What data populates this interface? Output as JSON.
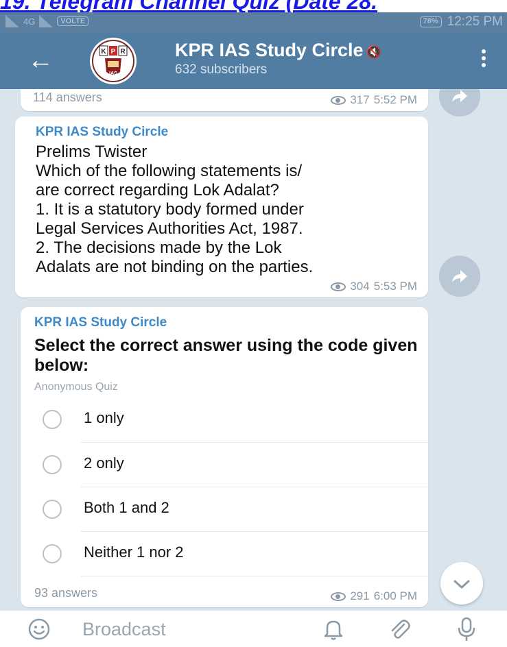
{
  "banner": {
    "text": "19. Telegram Channel Quiz (Date 28."
  },
  "status_bar": {
    "network": "4G",
    "volte": "VOLTE",
    "battery": "78%",
    "time": "12:25 PM"
  },
  "header": {
    "channel_name": "KPR IAS Study Circle",
    "subscribers": "632 subscribers",
    "avatar_text": "KPR"
  },
  "messages": [
    {
      "answers": "114 answers",
      "views": "317",
      "time": "5:52 PM"
    },
    {
      "sender": "KPR IAS Study Circle",
      "body": "Prelims Twister\nWhich of the following statements is/\nare correct regarding Lok Adalat?\n1.  It is a statutory body formed under\nLegal Services Authorities Act, 1987.\n2.  The decisions made by the Lok\nAdalats are not binding on the parties.",
      "views": "304",
      "time": "5:53 PM"
    },
    {
      "sender": "KPR IAS Study Circle",
      "question": "Select the correct answer using the code given below:",
      "quiz_type": "Anonymous Quiz",
      "options": [
        "1 only",
        "2 only",
        "Both 1 and 2",
        "Neither 1 nor 2"
      ],
      "answers": "93 answers",
      "views": "291",
      "time": "6:00 PM"
    }
  ],
  "bottom_bar": {
    "placeholder": "Broadcast"
  },
  "colors": {
    "header": "#527da3",
    "status_bar": "#5a7fa0",
    "sender": "#3e8ac8",
    "chat_bg": "#d9e4ec"
  }
}
